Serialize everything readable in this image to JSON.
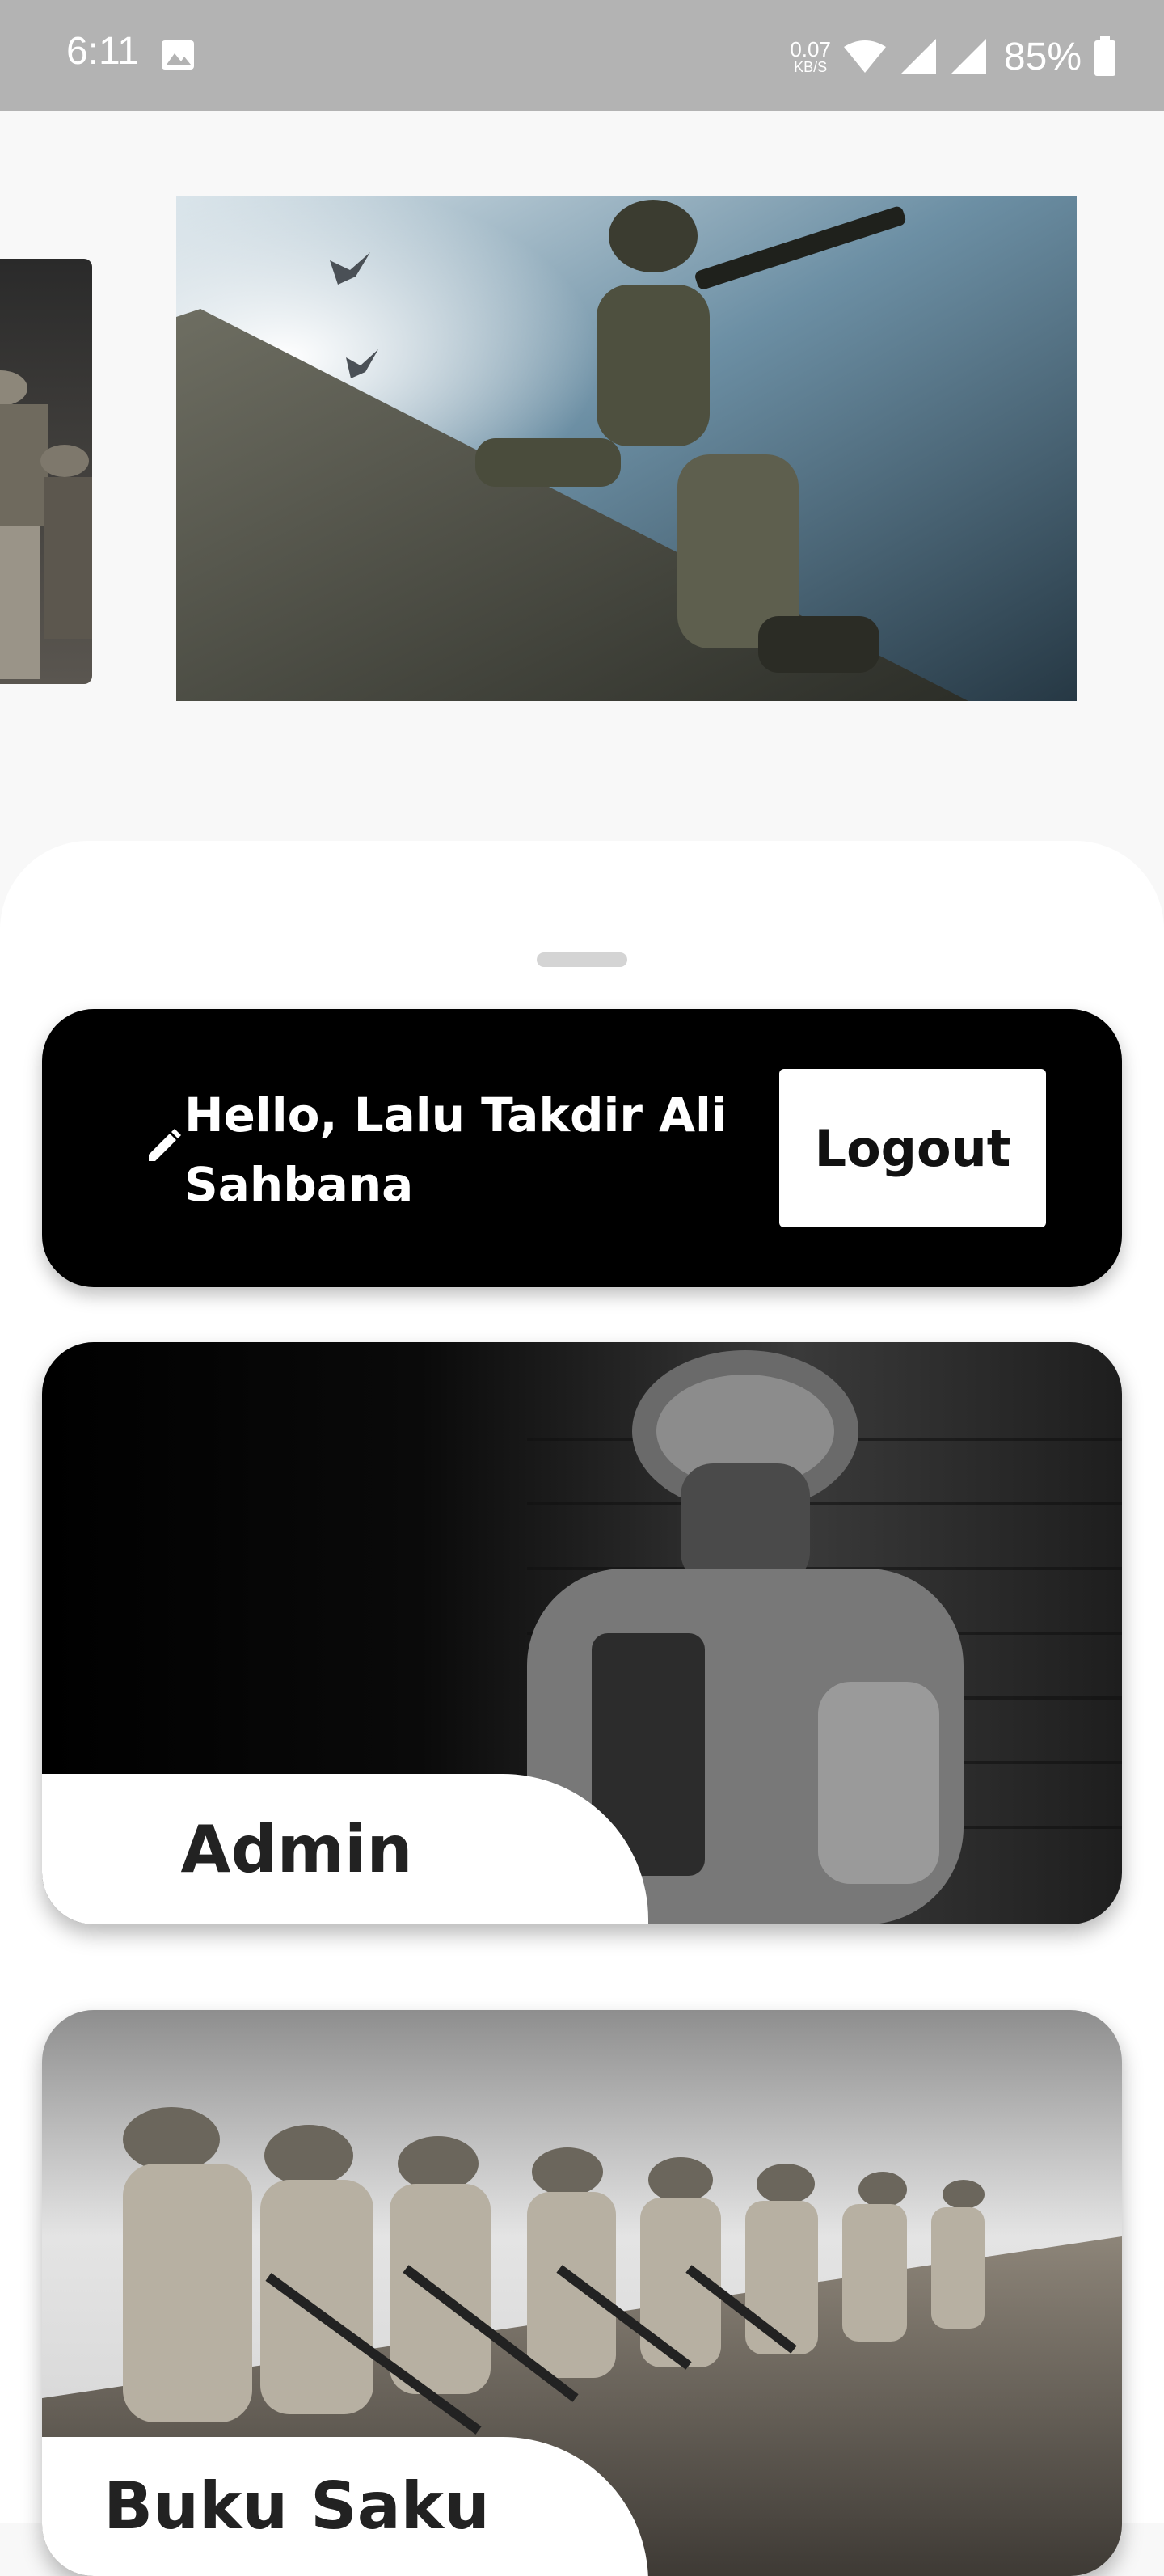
{
  "status_bar": {
    "time": "6:11",
    "net_speed_value": "0.07",
    "net_speed_unit": "KB/S",
    "battery": "85%",
    "icons": [
      "image-icon",
      "wifi-icon",
      "signal-icon",
      "signal-icon",
      "battery-icon"
    ]
  },
  "carousel": {
    "slides": [
      "soldiers-squad-image",
      "soldier-climbing-wall-image"
    ]
  },
  "greeting": {
    "icon": "pencil-icon",
    "text": "Hello, Lalu Takdir Ali Sahbana",
    "logout_label": "Logout"
  },
  "menu": [
    {
      "label": "Admin",
      "image": "soldier-portrait-image"
    },
    {
      "label": "Buku Saku",
      "image": "soldiers-kneeling-image"
    }
  ],
  "colors": {
    "status_bar": "#b3b3b3",
    "background": "#f8f8f8",
    "greeting_card": "#000000",
    "sheet": "#ffffff"
  }
}
